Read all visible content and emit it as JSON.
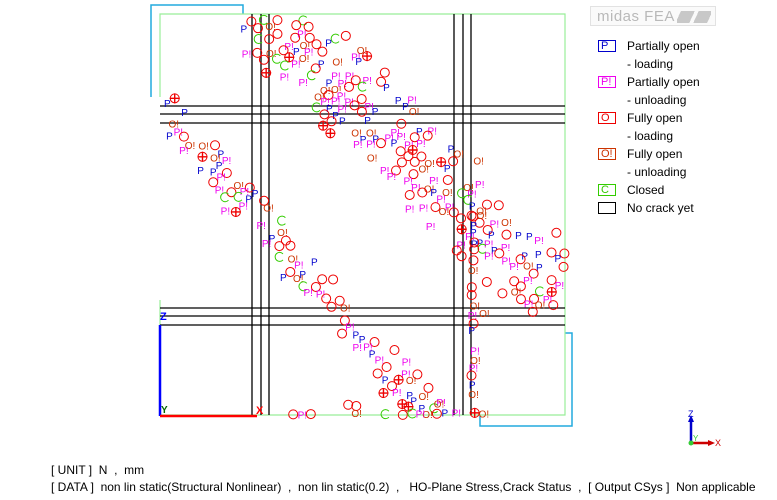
{
  "logo": {
    "text": "midas FEA"
  },
  "legend": {
    "items": [
      {
        "symbol": "P",
        "color": "#0000cc",
        "label": "Partially open",
        "sub": "- loading"
      },
      {
        "symbol": "P!",
        "color": "#ee00ee",
        "label": "Partially open",
        "sub": "- unloading"
      },
      {
        "symbol": "O",
        "color": "#ee0000",
        "label": "Fully open",
        "sub": "- loading"
      },
      {
        "symbol": "O!",
        "color": "#cc3300",
        "label": "Fully open",
        "sub": "- unloading"
      },
      {
        "symbol": "C",
        "color": "#33cc00",
        "label": "Closed",
        "sub": ""
      },
      {
        "symbol": "",
        "color": "#000000",
        "label": "No crack yet",
        "sub": ""
      }
    ]
  },
  "status": {
    "unit_line": "[ UNIT ]  N  ,  mm",
    "data_line": "[ DATA ]  non lin static(Structural Nonlinear)  ,  non lin static(0.2)  ,   HO-Plane Stress,Crack Status  ,  [ Output CSys ]  Non applicable"
  },
  "model_axes": {
    "vertical": "Z",
    "horizontal": "X",
    "out_of_plane": "Y"
  },
  "view_triad": {
    "z": "Z",
    "x": "X",
    "y": "Y"
  },
  "colors": {
    "boundary": "#99ee99",
    "frame": "#22aadd",
    "grid": "#000000",
    "partial_loading": "#0000cc",
    "partial_unloading": "#ee00ee",
    "full_loading": "#ee0000",
    "full_unloading": "#cc3300",
    "closed": "#33cc00"
  },
  "crack_bands": [
    {
      "note": "upper diagonal strut",
      "from": [
        0.24,
        0.0
      ],
      "to": [
        1.0,
        0.72
      ],
      "width": 0.22
    },
    {
      "note": "lower diagonal strut",
      "from": [
        0.0,
        0.24
      ],
      "to": [
        0.66,
        1.0
      ],
      "width": 0.09
    },
    {
      "note": "bottom edge",
      "from": [
        0.33,
        0.99
      ],
      "to": [
        0.84,
        0.99
      ],
      "width": 0.03
    },
    {
      "note": "left vertical column",
      "from": [
        0.775,
        0.5
      ],
      "to": [
        0.775,
        1.0
      ],
      "width": 0.04
    }
  ]
}
